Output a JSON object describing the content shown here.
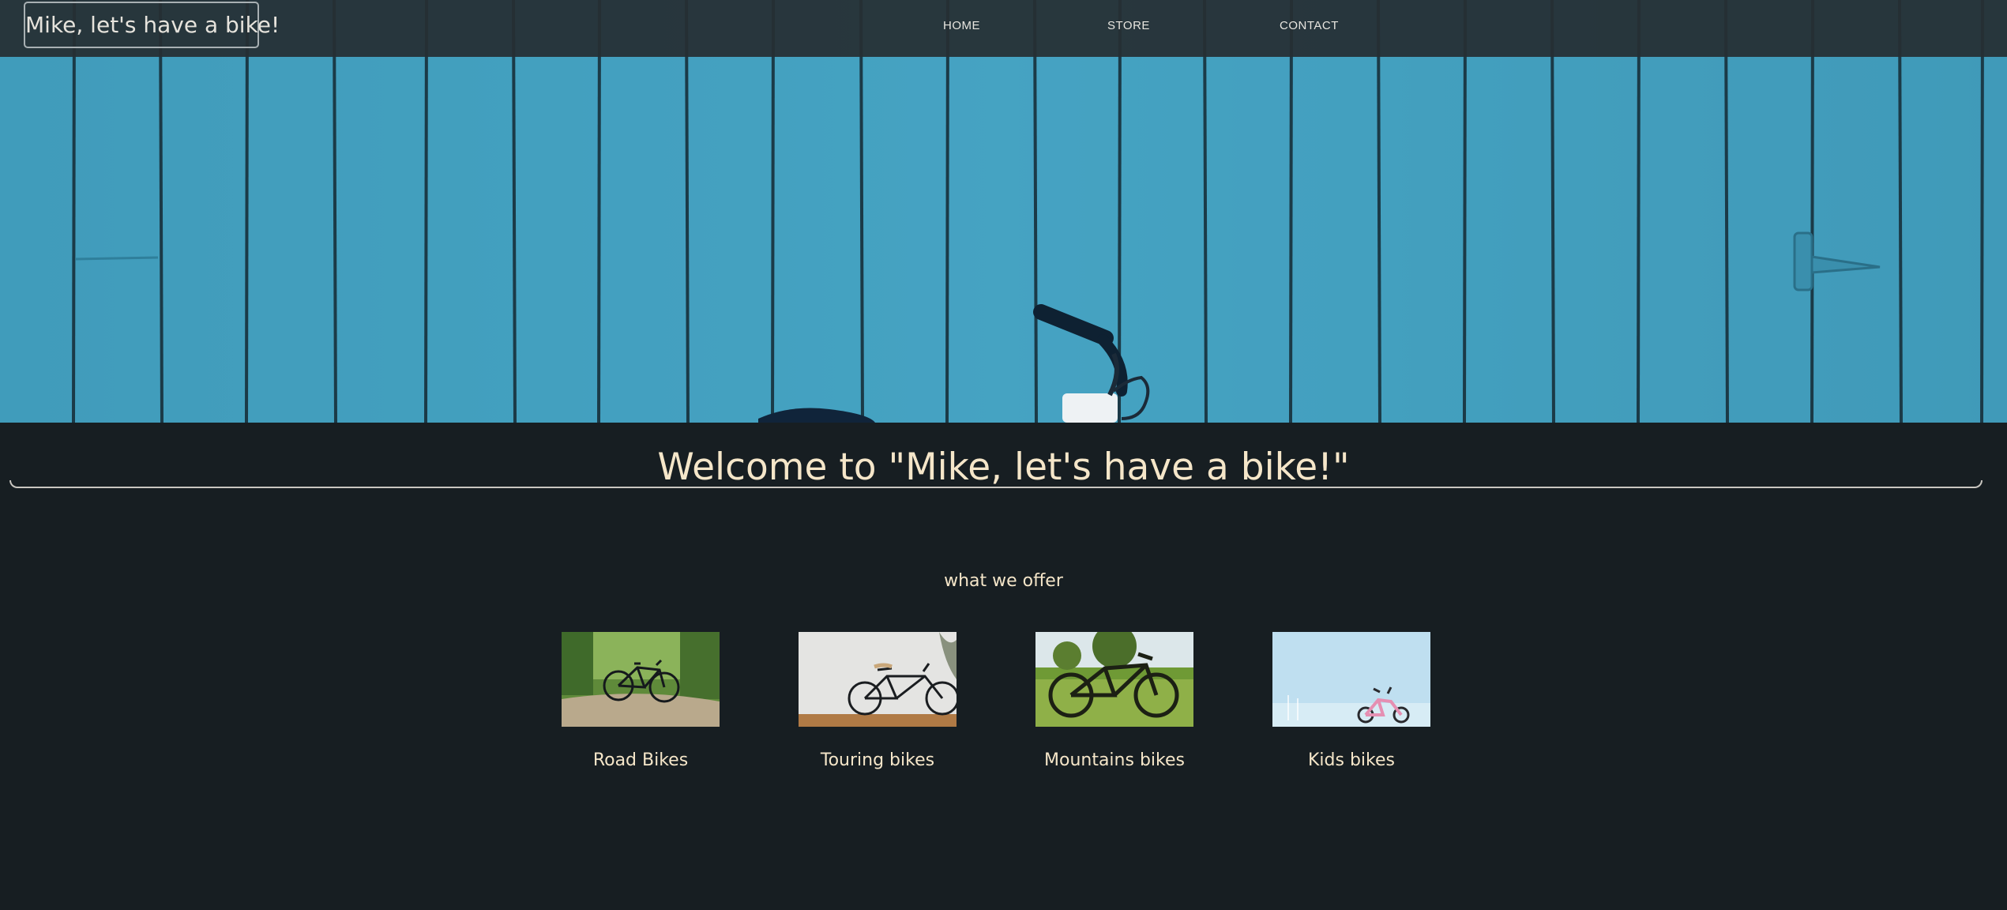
{
  "header": {
    "brand": "Mike, let's have a bike!",
    "nav": [
      {
        "label": "HOME"
      },
      {
        "label": "STORE"
      },
      {
        "label": "CONTACT"
      }
    ]
  },
  "hero": {
    "image": "blue-wooden-fence-with-bicycle"
  },
  "welcome": {
    "title": "Welcome to \"Mike, let's have a bike!\""
  },
  "offer": {
    "heading": "what we offer",
    "items": [
      {
        "label": "Road Bikes",
        "image": "road-bike-forest-photo"
      },
      {
        "label": "Touring bikes",
        "image": "touring-bike-white-wall-photo"
      },
      {
        "label": "Mountains bikes",
        "image": "mountain-bike-grass-photo"
      },
      {
        "label": "Kids bikes",
        "image": "kids-bike-sky-photo"
      }
    ]
  },
  "colors": {
    "background": "#171e22",
    "topbar": "#262e33",
    "accent_text": "#f5e6c9",
    "fence_blue": "#3f9dbd"
  }
}
